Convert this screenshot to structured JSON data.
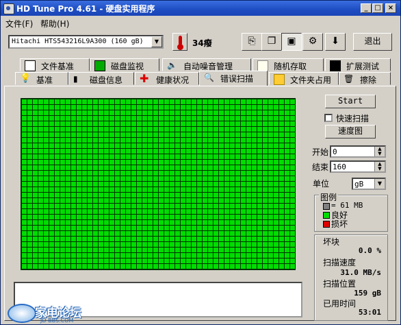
{
  "window": {
    "title": "HD Tune Pro 4.61 - 硬盘实用程序"
  },
  "menu": [
    {
      "label": "文件(F)"
    },
    {
      "label": "帮助(H)"
    }
  ],
  "drive_select": {
    "value": "Hitachi HTS543216L9A300 (160 gB)"
  },
  "temperature": {
    "value": "34癈"
  },
  "toolbar": {
    "exit_label": "退出"
  },
  "tabs_top": [
    {
      "label": "文件基准",
      "icon": "file-benchmark-icon"
    },
    {
      "label": "磁盘监视",
      "icon": "disk-monitor-icon"
    },
    {
      "label": "自动噪音管理",
      "icon": "speaker-icon"
    },
    {
      "label": "随机存取",
      "icon": "random-access-icon"
    },
    {
      "label": "扩展测试",
      "icon": "extra-tests-icon"
    }
  ],
  "tabs_bottom": [
    {
      "label": "基准",
      "icon": "benchmark-icon"
    },
    {
      "label": "磁盘信息",
      "icon": "info-icon"
    },
    {
      "label": "健康状况",
      "icon": "health-icon"
    },
    {
      "label": "错误扫描",
      "icon": "magnifier-icon",
      "active": true
    },
    {
      "label": "文件夹占用",
      "icon": "folder-icon"
    },
    {
      "label": "擦除",
      "icon": "trash-icon"
    }
  ],
  "controls": {
    "start_label": "Start",
    "quick_scan_label": "快速扫描",
    "speed_map_label": "速度图",
    "start_field_label": "开始",
    "start_value": "0",
    "end_field_label": "结束",
    "end_value": "160",
    "unit_label": "单位",
    "unit_value": "gB"
  },
  "legend": {
    "title": "图例",
    "block_label": "= 61 MB",
    "good_label": "良好",
    "bad_label": "损坏",
    "colors": {
      "block": "#808080",
      "good": "#00dd00",
      "bad": "#dd0000"
    }
  },
  "stats": {
    "damaged_label": "坏块",
    "damaged_value": "0.0 %",
    "scan_speed_label": "扫描速度",
    "scan_speed_value": "31.0 MB/s",
    "scan_position_label": "扫描位置",
    "scan_position_value": "159 gB",
    "elapsed_label": "已用时间",
    "elapsed_value": "53:01"
  },
  "watermark": {
    "text": "家电论坛",
    "subtext": "JD-BBS.COM"
  }
}
